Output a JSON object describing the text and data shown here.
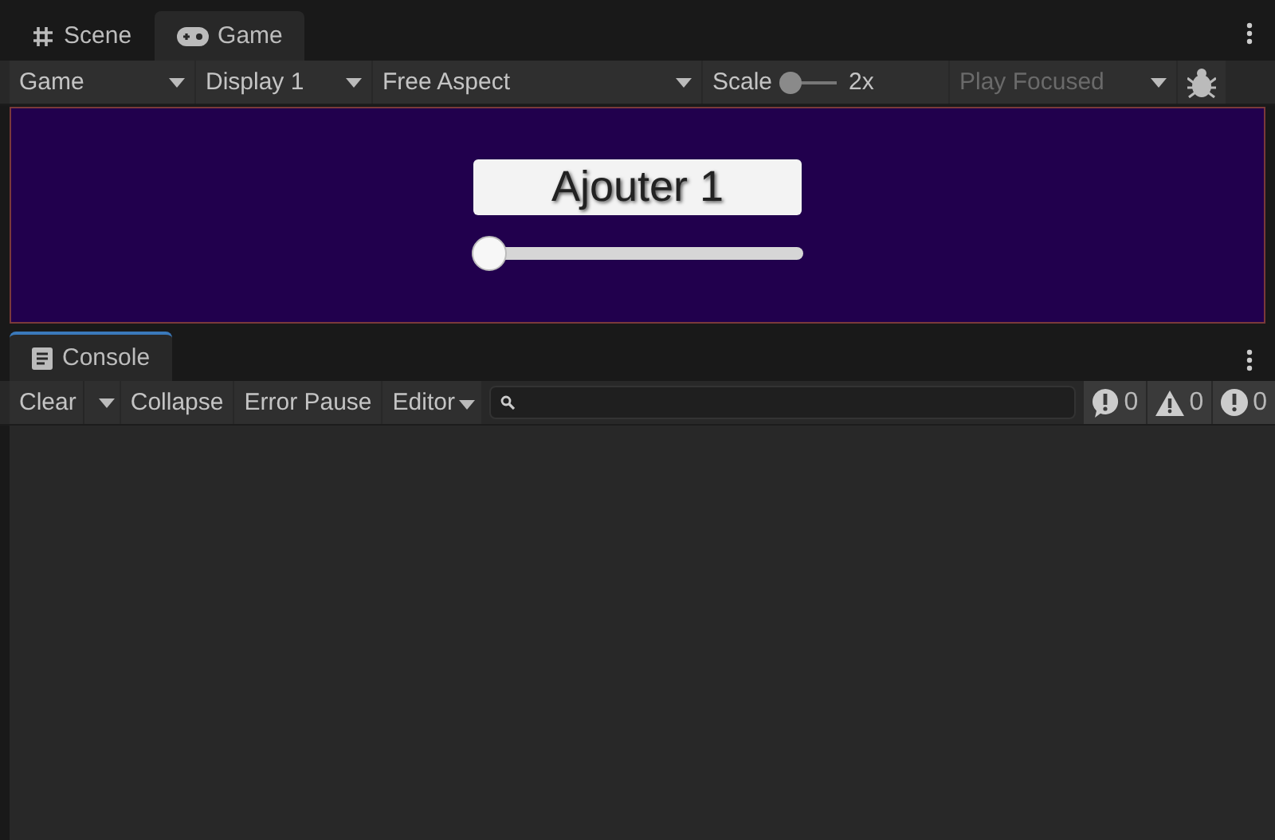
{
  "game_panel": {
    "tabs": [
      {
        "label": "Scene",
        "kind": "grid",
        "selected": false
      },
      {
        "label": "Game",
        "kind": "gamepad",
        "selected": true
      }
    ],
    "toolbar": {
      "mode": "Game",
      "display": "Display 1",
      "aspect": "Free Aspect",
      "scale_label": "Scale",
      "scale": {
        "level": 0.0
      },
      "scale_value": "2x",
      "play_mode": {
        "label": "Play Focused",
        "disabled": true
      }
    },
    "view": {
      "button": "Ajouter 1",
      "slider": {
        "level": 0.0
      }
    }
  },
  "console_panel": {
    "tabs": [
      {
        "label": "Console",
        "selected": true
      }
    ],
    "toolbar": {
      "clear": "Clear",
      "collapse": "Collapse",
      "error_pause": "Error Pause",
      "editor": "Editor"
    },
    "counters": [
      {
        "kind": "info",
        "count": "0"
      },
      {
        "kind": "warning",
        "count": "0"
      },
      {
        "kind": "error",
        "count": "0"
      }
    ]
  }
}
